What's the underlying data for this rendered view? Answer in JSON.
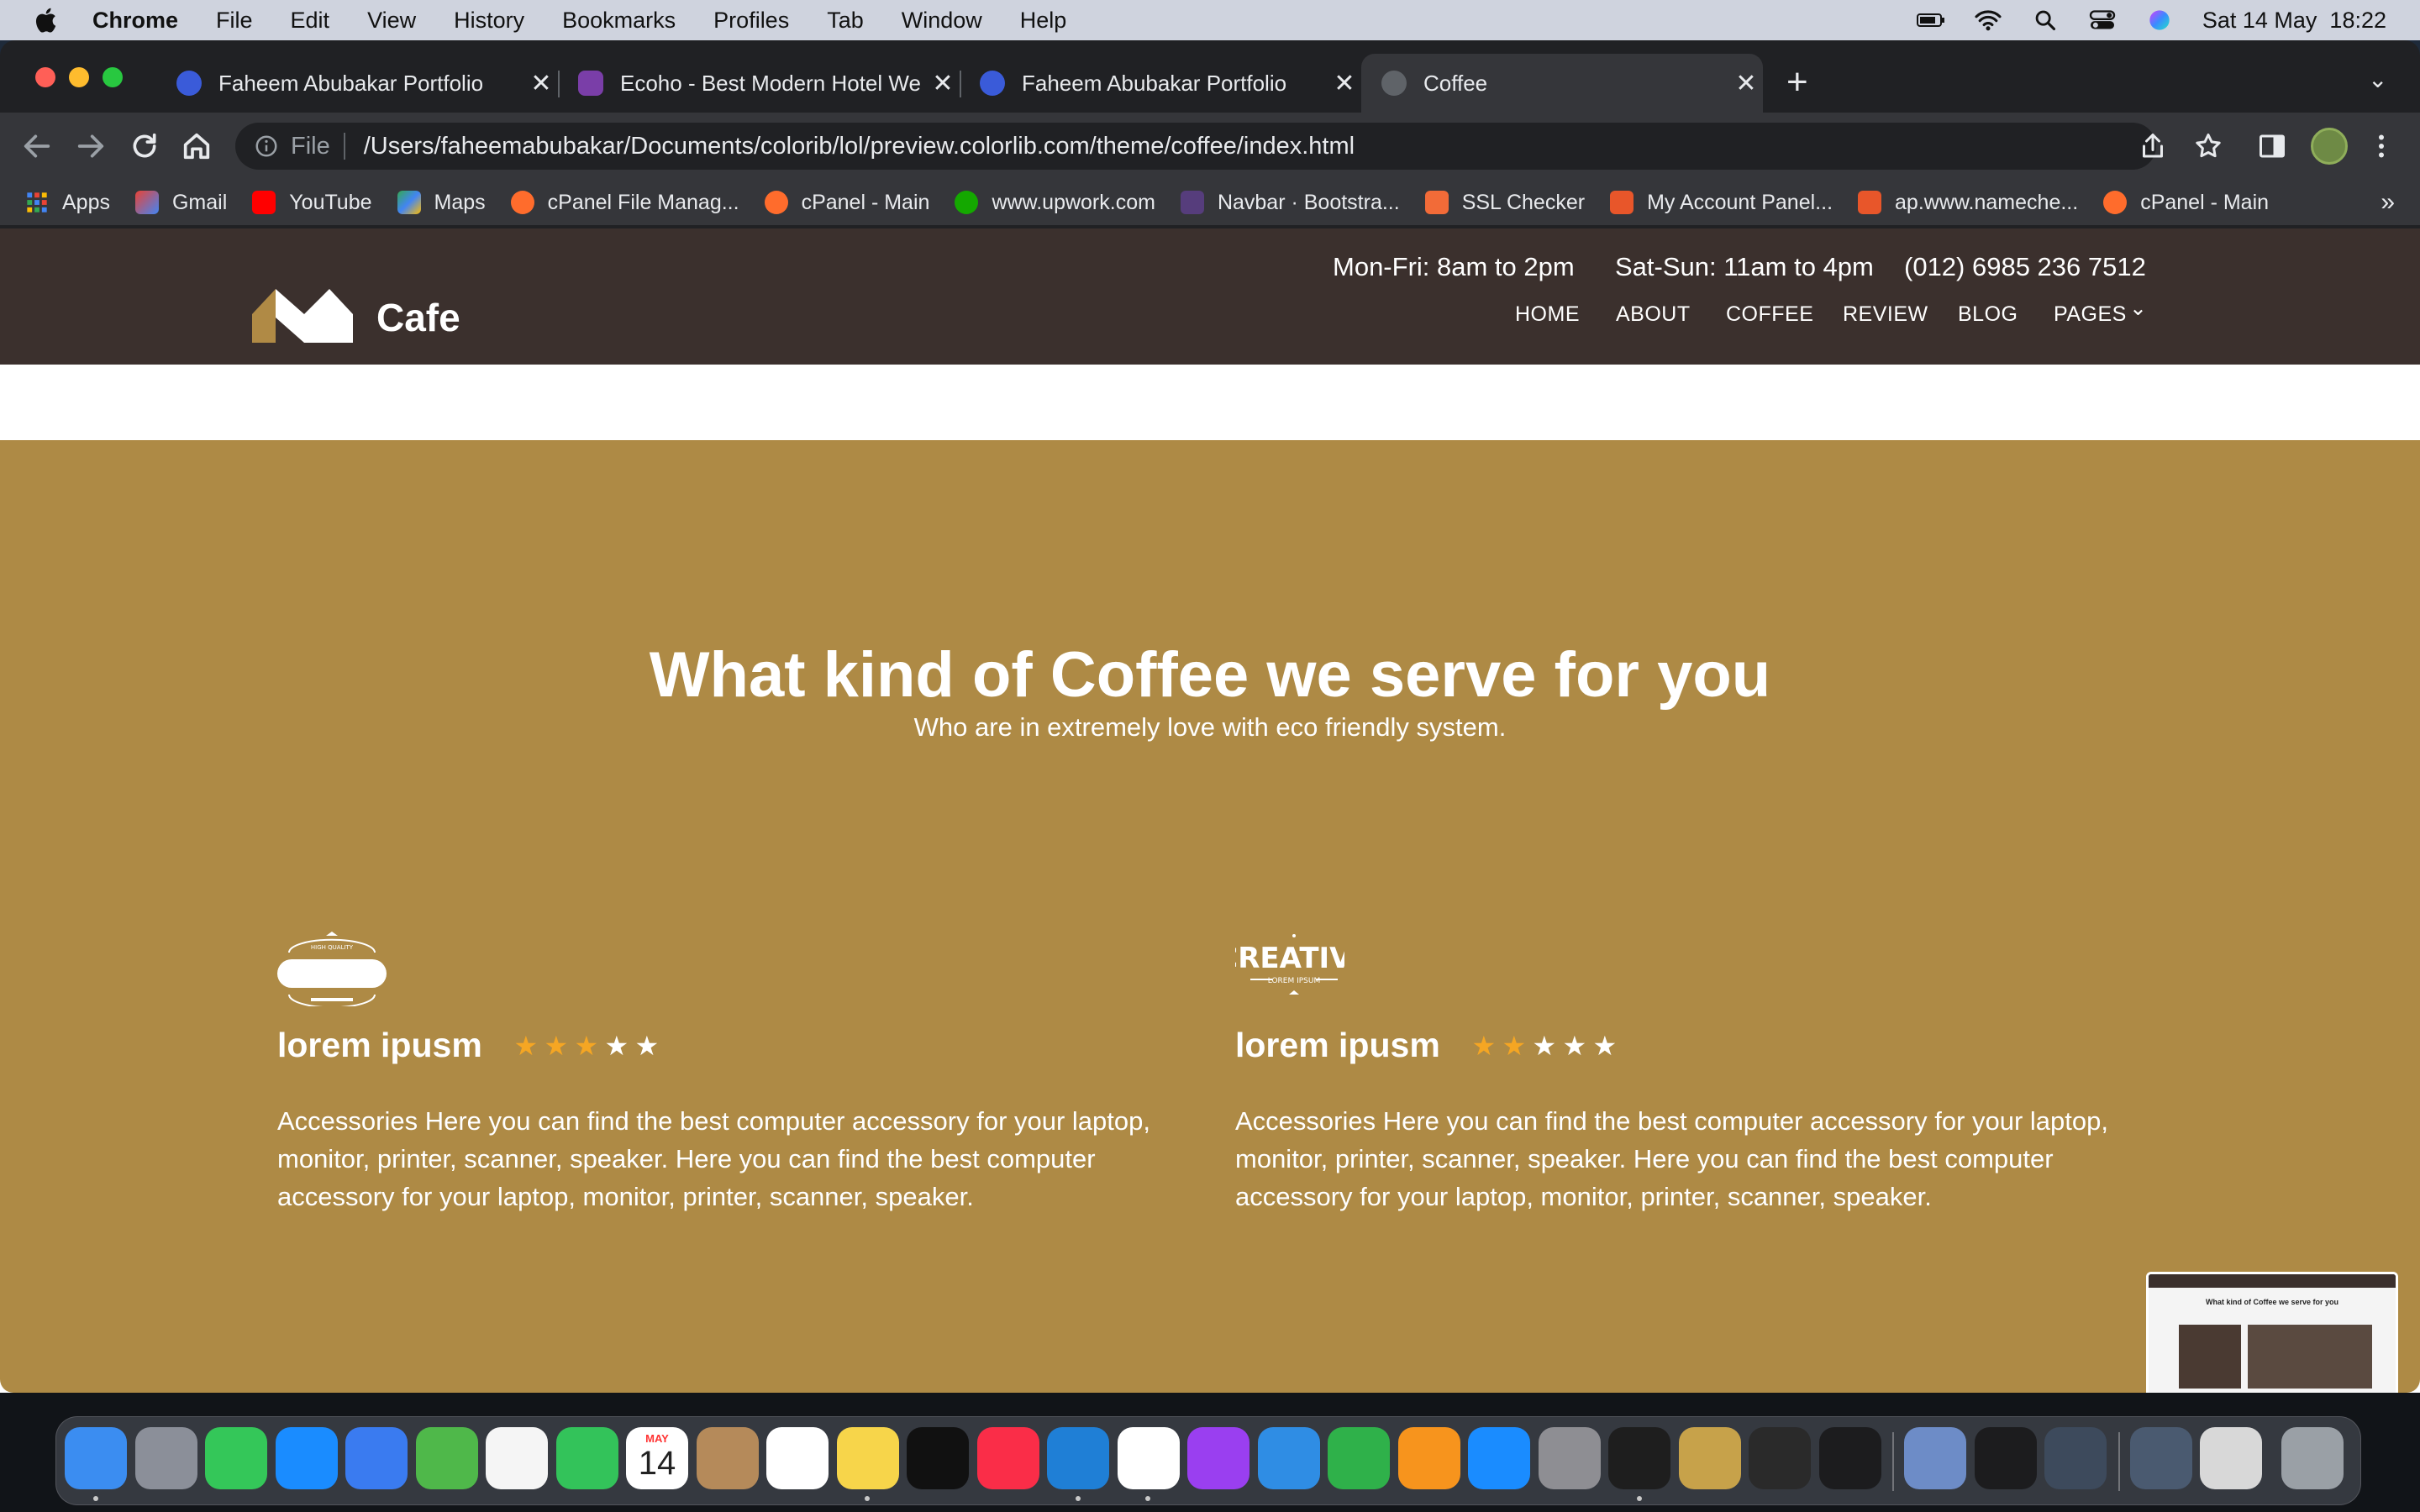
{
  "menubar": {
    "app": "Chrome",
    "items": [
      "File",
      "Edit",
      "View",
      "History",
      "Bookmarks",
      "Profiles",
      "Tab",
      "Window",
      "Help"
    ],
    "datetime": "Sat 14 May  18:22"
  },
  "tabs": [
    {
      "title": "Faheem Abubakar Portfolio",
      "close": "✕"
    },
    {
      "title": "Ecoho - Best Modern Hotel We",
      "close": "✕"
    },
    {
      "title": "Faheem Abubakar Portfolio",
      "close": "✕"
    },
    {
      "title": "Coffee",
      "close": "✕"
    }
  ],
  "new_tab": "+",
  "tab_search": "⌄",
  "address": {
    "scheme": "File",
    "url": "/Users/faheemabubakar/Documents/colorib/lol/preview.colorlib.com/theme/coffee/index.html"
  },
  "bookmarks": [
    "Apps",
    "Gmail",
    "YouTube",
    "Maps",
    "cPanel File Manag...",
    "cPanel - Main",
    "www.upwork.com",
    "Navbar · Bootstra...",
    "SSL Checker",
    "My Account Panel...",
    "ap.www.nameche...",
    "cPanel - Main"
  ],
  "bookmarks_more": "»",
  "site": {
    "logo_text": "Cafe",
    "hours_weekday": "Mon-Fri: 8am to 2pm",
    "hours_weekend": "Sat-Sun: 11am to 4pm",
    "phone": "(012) 6985 236 7512",
    "nav": [
      "HOME",
      "ABOUT",
      "COFFEE",
      "REVIEW",
      "BLOG",
      "PAGES"
    ],
    "nav_dropdown_glyph": "⌄"
  },
  "section": {
    "title": "What kind of Coffee we serve for you",
    "subtitle": "Who are in extremely love with eco friendly system.",
    "features": [
      {
        "badge": "HIGH QUALITY",
        "title": "lorem ipusm",
        "rating": 3,
        "max_rating": 5,
        "description": "Accessories Here you can find the best computer accessory for your laptop, monitor, printer, scanner, speaker. Here you can find the best computer accessory for your laptop, monitor, printer, scanner, speaker."
      },
      {
        "badge": "CREATIVE",
        "badge_sub": "LOREM IPSUM",
        "title": "lorem ipusm",
        "rating": 2,
        "max_rating": 5,
        "description": "Accessories Here you can find the best computer accessory for your laptop, monitor, printer, scanner, speaker. Here you can find the best computer accessory for your laptop, monitor, printer, scanner, speaker."
      }
    ]
  },
  "thumbnail": {
    "caption": "What kind of Coffee we serve for you"
  },
  "dock": {
    "calendar_month": "MAY",
    "calendar_day": "14",
    "apps": [
      "finder-icon",
      "launchpad-icon",
      "messages-icon",
      "safari-icon",
      "mail-icon",
      "maps-icon",
      "photos-icon",
      "facetime-icon",
      "calendar-icon",
      "contacts-icon",
      "reminders-icon",
      "notes-icon",
      "appletv-icon",
      "music-icon",
      "vscode-icon",
      "chrome-icon",
      "podcasts-icon",
      "keynote-icon",
      "numbers-icon",
      "pages-icon",
      "appstore-icon",
      "system-preferences-icon",
      "figma-icon",
      "archive-utility-icon",
      "vlc-icon",
      "terminal-icon",
      "preview-icon",
      "activity-monitor-icon",
      "quicktime-icon",
      "screenshot-folder-icon",
      "documents-folder-icon",
      "trash-icon"
    ]
  },
  "colors": {
    "header_bg": "#3b302d",
    "section_bg": "#ae8a45",
    "star_filled": "#f5a623",
    "star_empty": "#ffffff"
  }
}
